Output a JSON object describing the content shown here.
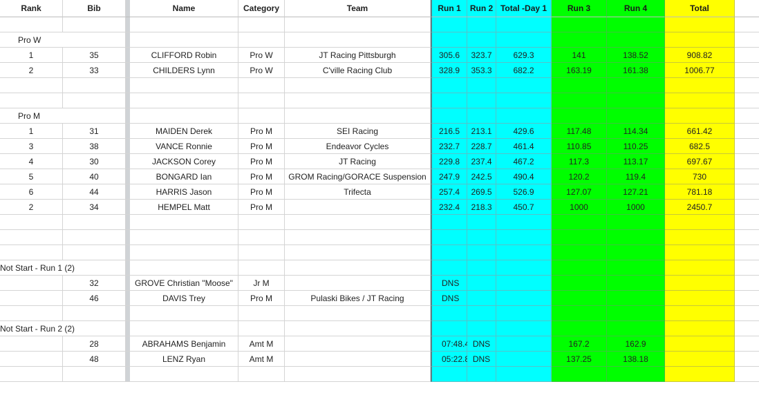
{
  "header": {
    "rank": "Rank",
    "bib": "Bib",
    "name": "Name",
    "category": "Category",
    "team": "Team",
    "run1": "Run 1",
    "run2": "Run 2",
    "total_day1": "Total -Day 1",
    "run3": "Run 3",
    "run4": "Run 4",
    "total": "Total"
  },
  "colors": {
    "day1": "#00ffff",
    "day2": "#00ff00",
    "total": "#ffff00"
  },
  "rows": [
    {
      "type": "blank"
    },
    {
      "type": "label",
      "text": "Pro W"
    },
    {
      "type": "data",
      "rank": "1",
      "bib": "35",
      "name": "CLIFFORD Robin",
      "category": "Pro W",
      "team": "JT Racing Pittsburgh",
      "run1": "305.6",
      "run2": "323.7",
      "total_day1": "629.3",
      "run3": "141",
      "run4": "138.52",
      "total": "908.82"
    },
    {
      "type": "data",
      "rank": "2",
      "bib": "33",
      "name": "CHILDERS Lynn",
      "category": "Pro W",
      "team": "C'ville Racing Club",
      "run1": "328.9",
      "run2": "353.3",
      "total_day1": "682.2",
      "run3": "163.19",
      "run4": "161.38",
      "total": "1006.77"
    },
    {
      "type": "blank"
    },
    {
      "type": "blank"
    },
    {
      "type": "label",
      "text": "Pro M"
    },
    {
      "type": "data",
      "rank": "1",
      "bib": "31",
      "name": "MAIDEN Derek",
      "category": "Pro M",
      "team": "SEI Racing",
      "run1": "216.5",
      "run2": "213.1",
      "total_day1": "429.6",
      "run3": "117.48",
      "run4": "114.34",
      "total": "661.42"
    },
    {
      "type": "data",
      "rank": "3",
      "bib": "38",
      "name": "VANCE Ronnie",
      "category": "Pro M",
      "team": "Endeavor Cycles",
      "run1": "232.7",
      "run2": "228.7",
      "total_day1": "461.4",
      "run3": "110.85",
      "run4": "110.25",
      "total": "682.5"
    },
    {
      "type": "data",
      "rank": "4",
      "bib": "30",
      "name": "JACKSON Corey",
      "category": "Pro M",
      "team": "JT Racing",
      "run1": "229.8",
      "run2": "237.4",
      "total_day1": "467.2",
      "run3": "117.3",
      "run4": "113.17",
      "total": "697.67"
    },
    {
      "type": "data",
      "rank": "5",
      "bib": "40",
      "name": "BONGARD Ian",
      "category": "Pro M",
      "team": "GROM Racing/GORACE Suspension",
      "run1": "247.9",
      "run2": "242.5",
      "total_day1": "490.4",
      "run3": "120.2",
      "run4": "119.4",
      "total": "730"
    },
    {
      "type": "data",
      "rank": "6",
      "bib": "44",
      "name": "HARRIS Jason",
      "category": "Pro M",
      "team": "Trifecta",
      "run1": "257.4",
      "run2": "269.5",
      "total_day1": "526.9",
      "run3": "127.07",
      "run4": "127.21",
      "total": "781.18"
    },
    {
      "type": "data",
      "rank": "2",
      "bib": "34",
      "name": "HEMPEL Matt",
      "category": "Pro M",
      "team": "",
      "run1": "232.4",
      "run2": "218.3",
      "total_day1": "450.7",
      "run3": "1000",
      "run4": "1000",
      "total": "2450.7"
    },
    {
      "type": "blank"
    },
    {
      "type": "blank"
    },
    {
      "type": "blank"
    },
    {
      "type": "label-ns",
      "text": "Not Start - Run 1 (2)"
    },
    {
      "type": "data",
      "rank": "",
      "bib": "32",
      "name": "GROVE Christian \"Moose\"",
      "category": "Jr M",
      "team": "",
      "run1": "DNS",
      "run2": "",
      "total_day1": "",
      "run3": "",
      "run4": "",
      "total": ""
    },
    {
      "type": "data",
      "rank": "",
      "bib": "46",
      "name": "DAVIS Trey",
      "category": "Pro M",
      "team": "Pulaski Bikes / JT Racing",
      "run1": "DNS",
      "run2": "",
      "total_day1": "",
      "run3": "",
      "run4": "",
      "total": ""
    },
    {
      "type": "blank"
    },
    {
      "type": "label-ns",
      "text": "Not Start - Run 2 (2)"
    },
    {
      "type": "data",
      "rank": "",
      "bib": "28",
      "name": "ABRAHAMS Benjamin",
      "category": "Amt M",
      "team": "",
      "run1": "07:48.4",
      "run2": "DNS",
      "total_day1": "",
      "run3": "167.2",
      "run4": "162.9",
      "total": ""
    },
    {
      "type": "data",
      "rank": "",
      "bib": "48",
      "name": "LENZ Ryan",
      "category": "Amt M",
      "team": "",
      "run1": "05:22.8",
      "run2": "DNS",
      "total_day1": "",
      "run3": "137.25",
      "run4": "138.18",
      "total": ""
    },
    {
      "type": "blank"
    }
  ]
}
